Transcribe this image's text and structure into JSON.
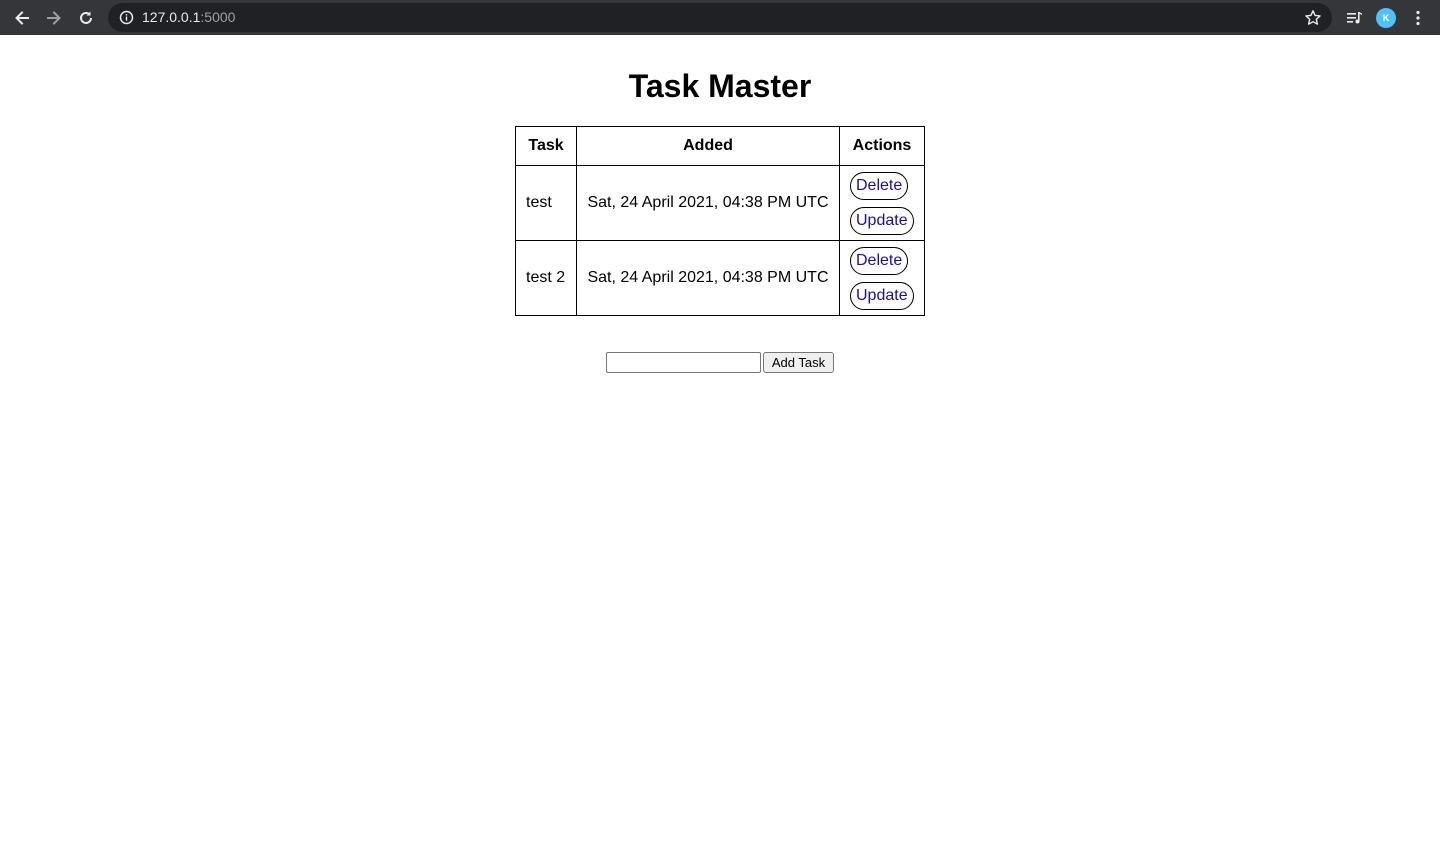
{
  "browser": {
    "url_host": "127.0.0.1",
    "url_port": ":5000"
  },
  "page": {
    "title": "Task Master",
    "table": {
      "headers": [
        "Task",
        "Added",
        "Actions"
      ],
      "rows": [
        {
          "task": "test",
          "added": "Sat, 24 April 2021, 04:38 PM UTC",
          "delete_label": "Delete",
          "update_label": "Update"
        },
        {
          "task": "test 2",
          "added": "Sat, 24 April 2021, 04:38 PM UTC",
          "delete_label": "Delete",
          "update_label": "Update"
        }
      ]
    },
    "form": {
      "input_value": "",
      "submit_label": "Add Task"
    }
  },
  "colors": {
    "chrome_bg": "#35363a",
    "omnibox_bg": "#202124",
    "link": "#1d0da5",
    "avatar": "#4fc3f7"
  },
  "icons": [
    "back-arrow-icon",
    "forward-arrow-icon",
    "reload-icon",
    "info-icon",
    "star-icon",
    "media-control-icon",
    "profile-avatar-icon",
    "kebab-menu-icon"
  ]
}
